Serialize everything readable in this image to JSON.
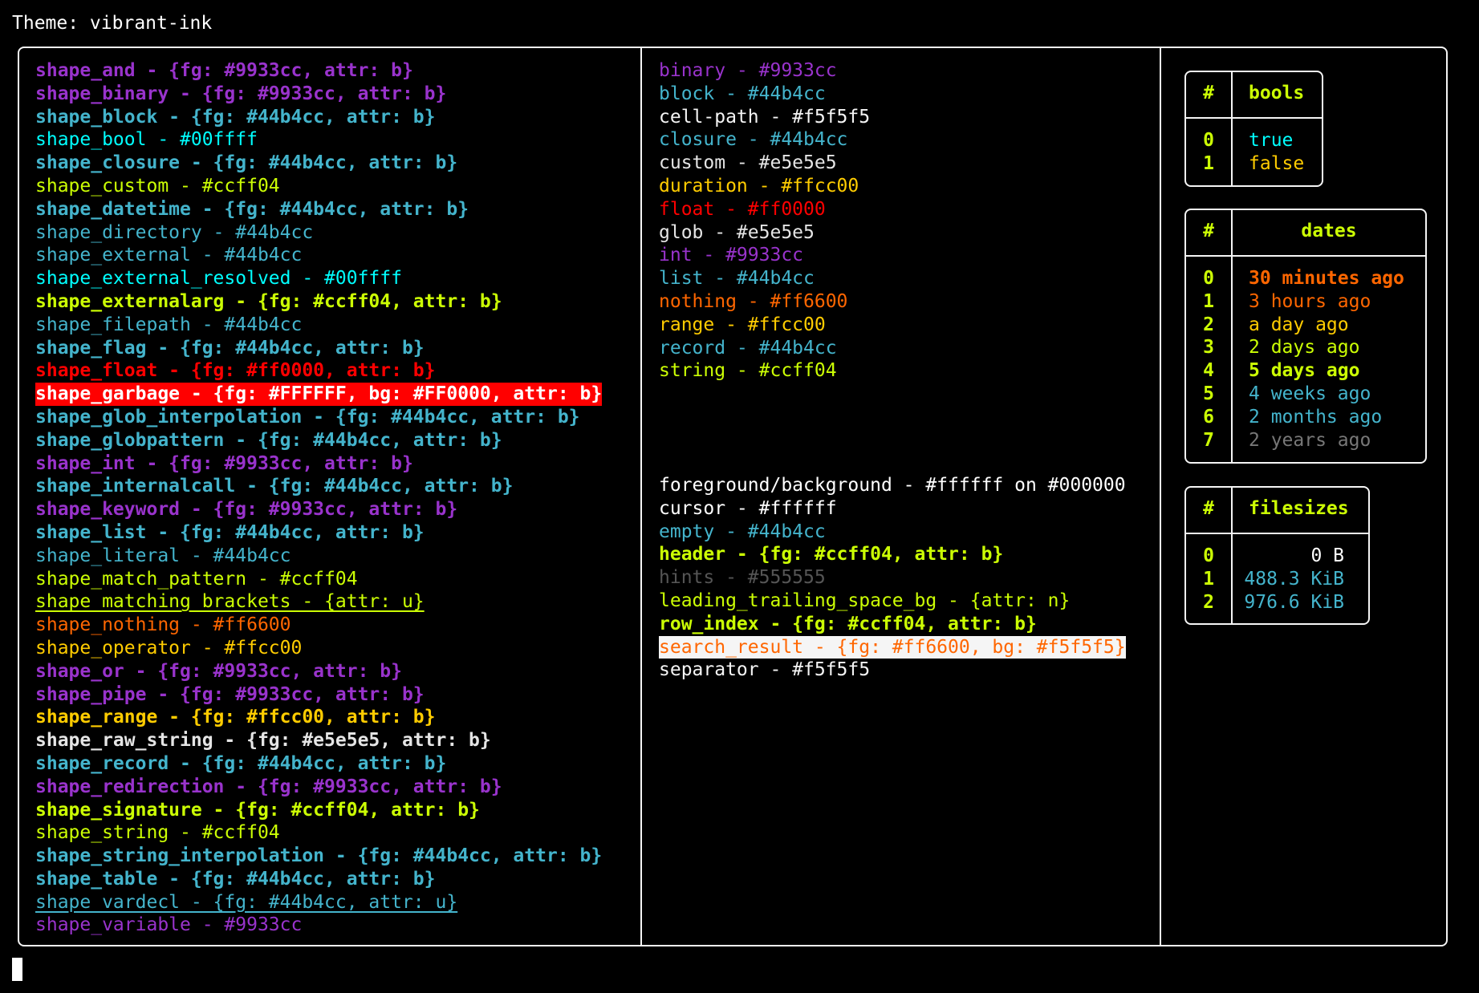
{
  "title": "Theme: vibrant-ink",
  "left_column": [
    {
      "text": "shape_and - {fg: #9933cc, attr: b}",
      "color": "#9933cc",
      "bold": true
    },
    {
      "text": "shape_binary - {fg: #9933cc, attr: b}",
      "color": "#9933cc",
      "bold": true
    },
    {
      "text": "shape_block - {fg: #44b4cc, attr: b}",
      "color": "#44b4cc",
      "bold": true
    },
    {
      "text": "shape_bool - #00ffff",
      "color": "#00ffff"
    },
    {
      "text": "shape_closure - {fg: #44b4cc, attr: b}",
      "color": "#44b4cc",
      "bold": true
    },
    {
      "text": "shape_custom - #ccff04",
      "color": "#ccff04"
    },
    {
      "text": "shape_datetime - {fg: #44b4cc, attr: b}",
      "color": "#44b4cc",
      "bold": true
    },
    {
      "text": "shape_directory - #44b4cc",
      "color": "#44b4cc"
    },
    {
      "text": "shape_external - #44b4cc",
      "color": "#44b4cc"
    },
    {
      "text": "shape_external_resolved - #00ffff",
      "color": "#00ffff"
    },
    {
      "text": "shape_externalarg - {fg: #ccff04, attr: b}",
      "color": "#ccff04",
      "bold": true
    },
    {
      "text": "shape_filepath - #44b4cc",
      "color": "#44b4cc"
    },
    {
      "text": "shape_flag - {fg: #44b4cc, attr: b}",
      "color": "#44b4cc",
      "bold": true
    },
    {
      "text": "shape_float - {fg: #ff0000, attr: b}",
      "color": "#ff0000",
      "bold": true
    },
    {
      "text": "shape_garbage - {fg: #FFFFFF, bg: #FF0000, attr: b}",
      "color": "#ffffff",
      "bg": "#ff0000",
      "bold": true
    },
    {
      "text": "shape_glob_interpolation - {fg: #44b4cc, attr: b}",
      "color": "#44b4cc",
      "bold": true
    },
    {
      "text": "shape_globpattern - {fg: #44b4cc, attr: b}",
      "color": "#44b4cc",
      "bold": true
    },
    {
      "text": "shape_int - {fg: #9933cc, attr: b}",
      "color": "#9933cc",
      "bold": true
    },
    {
      "text": "shape_internalcall - {fg: #44b4cc, attr: b}",
      "color": "#44b4cc",
      "bold": true
    },
    {
      "text": "shape_keyword - {fg: #9933cc, attr: b}",
      "color": "#9933cc",
      "bold": true
    },
    {
      "text": "shape_list - {fg: #44b4cc, attr: b}",
      "color": "#44b4cc",
      "bold": true
    },
    {
      "text": "shape_literal - #44b4cc",
      "color": "#44b4cc"
    },
    {
      "text": "shape_match_pattern - #ccff04",
      "color": "#ccff04"
    },
    {
      "text": "shape_matching_brackets - {attr: u}",
      "color": "#ccff04",
      "underline": true
    },
    {
      "text": "shape_nothing - #ff6600",
      "color": "#ff6600"
    },
    {
      "text": "shape_operator - #ffcc00",
      "color": "#ffcc00"
    },
    {
      "text": "shape_or - {fg: #9933cc, attr: b}",
      "color": "#9933cc",
      "bold": true
    },
    {
      "text": "shape_pipe - {fg: #9933cc, attr: b}",
      "color": "#9933cc",
      "bold": true
    },
    {
      "text": "shape_range - {fg: #ffcc00, attr: b}",
      "color": "#ffcc00",
      "bold": true
    },
    {
      "text": "shape_raw_string - {fg: #e5e5e5, attr: b}",
      "color": "#e5e5e5",
      "bold": true
    },
    {
      "text": "shape_record - {fg: #44b4cc, attr: b}",
      "color": "#44b4cc",
      "bold": true
    },
    {
      "text": "shape_redirection - {fg: #9933cc, attr: b}",
      "color": "#9933cc",
      "bold": true
    },
    {
      "text": "shape_signature - {fg: #ccff04, attr: b}",
      "color": "#ccff04",
      "bold": true
    },
    {
      "text": "shape_string - #ccff04",
      "color": "#ccff04"
    },
    {
      "text": "shape_string_interpolation - {fg: #44b4cc, attr: b}",
      "color": "#44b4cc",
      "bold": true
    },
    {
      "text": "shape_table - {fg: #44b4cc, attr: b}",
      "color": "#44b4cc",
      "bold": true
    },
    {
      "text": "shape_vardecl - {fg: #44b4cc, attr: u}",
      "color": "#44b4cc",
      "underline": true
    },
    {
      "text": "shape_variable - #9933cc",
      "color": "#9933cc"
    }
  ],
  "middle_column_types": [
    {
      "text": "binary - #9933cc",
      "color": "#9933cc"
    },
    {
      "text": "block - #44b4cc",
      "color": "#44b4cc"
    },
    {
      "text": "cell-path - #f5f5f5",
      "color": "#f5f5f5"
    },
    {
      "text": "closure - #44b4cc",
      "color": "#44b4cc"
    },
    {
      "text": "custom - #e5e5e5",
      "color": "#e5e5e5"
    },
    {
      "text": "duration - #ffcc00",
      "color": "#ffcc00"
    },
    {
      "text": "float - #ff0000",
      "color": "#ff0000"
    },
    {
      "text": "glob - #e5e5e5",
      "color": "#e5e5e5"
    },
    {
      "text": "int - #9933cc",
      "color": "#9933cc"
    },
    {
      "text": "list - #44b4cc",
      "color": "#44b4cc"
    },
    {
      "text": "nothing - #ff6600",
      "color": "#ff6600"
    },
    {
      "text": "range - #ffcc00",
      "color": "#ffcc00"
    },
    {
      "text": "record - #44b4cc",
      "color": "#44b4cc"
    },
    {
      "text": "string - #ccff04",
      "color": "#ccff04"
    }
  ],
  "middle_column_ui": [
    {
      "text": "foreground/background - #ffffff on #000000",
      "color": "#ffffff"
    },
    {
      "text": "cursor - #ffffff",
      "color": "#ffffff"
    },
    {
      "text": "empty - #44b4cc",
      "color": "#44b4cc"
    },
    {
      "text": "header - {fg: #ccff04, attr: b}",
      "color": "#ccff04",
      "bold": true
    },
    {
      "text": "hints - #555555",
      "color": "#555555"
    },
    {
      "text": "leading_trailing_space_bg - {attr: n}",
      "color": "#ccff04"
    },
    {
      "text": "row_index - {fg: #ccff04, attr: b}",
      "color": "#ccff04",
      "bold": true
    },
    {
      "text": "search_result - {fg: #ff6600, bg: #f5f5f5}",
      "color": "#ff6600",
      "bg": "#f5f5f5"
    },
    {
      "text": "separator - #f5f5f5",
      "color": "#f5f5f5"
    }
  ],
  "tables": {
    "bools": {
      "index_header": "#",
      "header": "bools",
      "rows": [
        {
          "index": "0",
          "value": "true",
          "color": "#00ffff"
        },
        {
          "index": "1",
          "value": "false",
          "color": "#ffcc00"
        }
      ]
    },
    "dates": {
      "index_header": "#",
      "header": "dates",
      "rows": [
        {
          "index": "0",
          "value": "30 minutes ago",
          "color": "#ff6600",
          "bold": true
        },
        {
          "index": "1",
          "value": "3 hours ago",
          "color": "#ff6600"
        },
        {
          "index": "2",
          "value": "a day ago",
          "color": "#ffcc00"
        },
        {
          "index": "3",
          "value": "2 days ago",
          "color": "#ccff04"
        },
        {
          "index": "4",
          "value": "5 days ago",
          "color": "#ccff04",
          "bold": true
        },
        {
          "index": "5",
          "value": "4 weeks ago",
          "color": "#44b4cc"
        },
        {
          "index": "6",
          "value": "2 months ago",
          "color": "#44b4cc"
        },
        {
          "index": "7",
          "value": "2 years ago",
          "color": "#777777"
        }
      ]
    },
    "filesizes": {
      "index_header": "#",
      "header": "filesizes",
      "rows": [
        {
          "index": "0",
          "value": "0 B",
          "color": "#ffffff"
        },
        {
          "index": "1",
          "value": "488.3 KiB",
          "color": "#44b4cc"
        },
        {
          "index": "2",
          "value": "976.6 KiB",
          "color": "#44b4cc"
        }
      ]
    }
  }
}
